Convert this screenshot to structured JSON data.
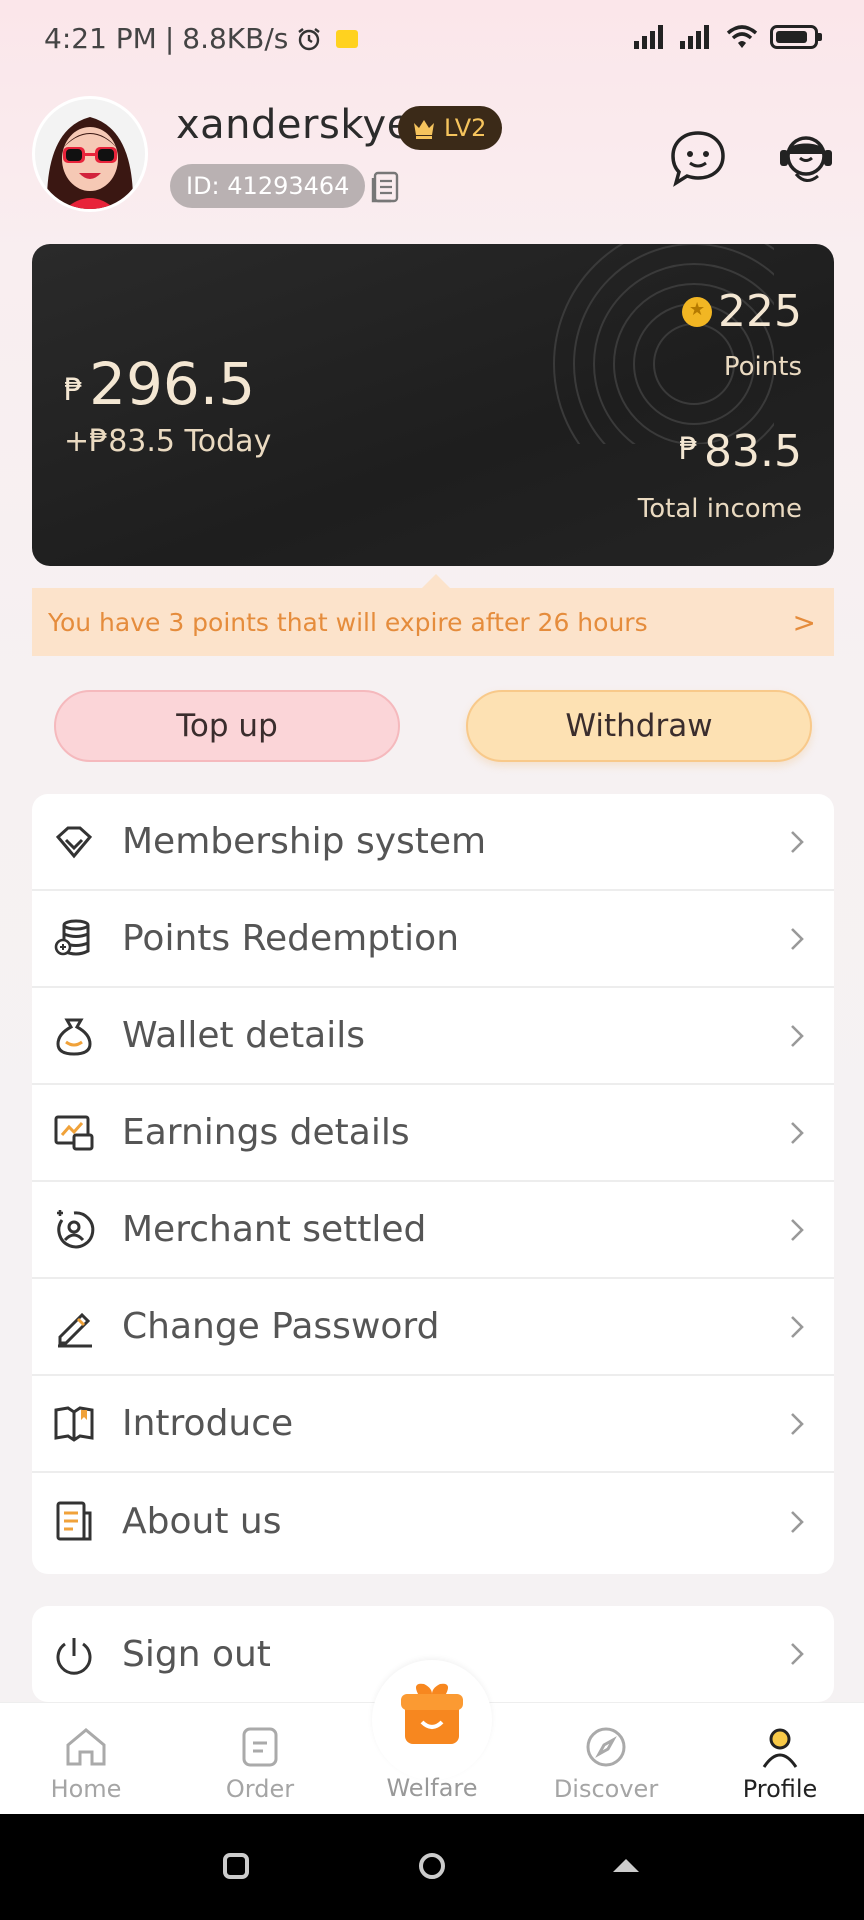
{
  "status_bar": {
    "time": "4:21 PM",
    "speed": "8.8KB/s",
    "icons": [
      "alarm-icon",
      "message-badge-icon",
      "signal-icon",
      "signal-icon",
      "wifi-icon",
      "battery-icon"
    ],
    "battery_level": 0.85
  },
  "profile": {
    "username": "xanderskye",
    "level": "LV2",
    "id_text": "ID: 41293464"
  },
  "wallet": {
    "currency_symbol": "₱",
    "balance": "296.5",
    "today": "+₱83.5 Today",
    "points_value": "225",
    "points_label": "Points",
    "income_value": "83.5",
    "income_label": "Total income"
  },
  "notice": {
    "text": "You have 3 points that will expire after 26 hours",
    "chevron": ">"
  },
  "actions": {
    "topup_label": "Top up",
    "withdraw_label": "Withdraw"
  },
  "menu": [
    {
      "label": "Membership system",
      "icon": "diamond-icon"
    },
    {
      "label": "Points Redemption",
      "icon": "coin-stack-icon"
    },
    {
      "label": "Wallet details",
      "icon": "money-bag-icon"
    },
    {
      "label": "Earnings details",
      "icon": "chart-screen-icon"
    },
    {
      "label": "Merchant settled",
      "icon": "merchant-user-icon"
    },
    {
      "label": "Change Password",
      "icon": "pencil-icon"
    },
    {
      "label": "Introduce",
      "icon": "book-icon"
    },
    {
      "label": "About us",
      "icon": "document-icon"
    }
  ],
  "signout": {
    "label": "Sign out",
    "icon": "power-icon"
  },
  "bottom_nav": [
    {
      "label": "Home",
      "icon": "home-icon",
      "active": false
    },
    {
      "label": "Order",
      "icon": "order-icon",
      "active": false
    },
    {
      "label": "Welfare",
      "icon": "gift-icon",
      "active": false
    },
    {
      "label": "Discover",
      "icon": "compass-icon",
      "active": false
    },
    {
      "label": "Profile",
      "icon": "person-icon",
      "active": true
    }
  ],
  "colors": {
    "accent_gold": "#f6c45d",
    "card_dark": "#222222",
    "notice_bg": "#fce3cb",
    "notice_text": "#e58c3c",
    "topup_bg": "#fbd5d8",
    "withdraw_bg": "#fde1b3",
    "welfare_orange": "#f7871f"
  }
}
